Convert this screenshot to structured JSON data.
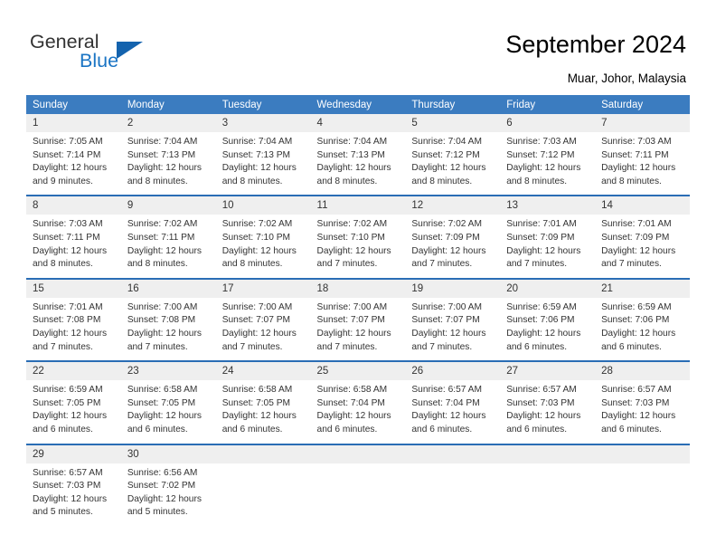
{
  "brand": {
    "name_top": "General",
    "name_bottom": "Blue",
    "triangle_color": "#1463ae",
    "text_color": "#333333",
    "blue_color": "#1a74c4"
  },
  "header": {
    "title": "September 2024",
    "location": "Muar, Johor, Malaysia"
  },
  "theme": {
    "header_row_bg": "#3b7cc0",
    "header_row_text": "#ffffff",
    "daynum_bg": "#efefef",
    "week_separator": "#2a6db5",
    "body_text": "#333333"
  },
  "weekday_headers": [
    "Sunday",
    "Monday",
    "Tuesday",
    "Wednesday",
    "Thursday",
    "Friday",
    "Saturday"
  ],
  "labels": {
    "sunrise_prefix": "Sunrise: ",
    "sunset_prefix": "Sunset: ",
    "daylight_prefix": "Daylight: "
  },
  "weeks": [
    [
      {
        "day": "1",
        "sunrise": "Sunrise: 7:05 AM",
        "sunset": "Sunset: 7:14 PM",
        "daylight": "Daylight: 12 hours and 9 minutes."
      },
      {
        "day": "2",
        "sunrise": "Sunrise: 7:04 AM",
        "sunset": "Sunset: 7:13 PM",
        "daylight": "Daylight: 12 hours and 8 minutes."
      },
      {
        "day": "3",
        "sunrise": "Sunrise: 7:04 AM",
        "sunset": "Sunset: 7:13 PM",
        "daylight": "Daylight: 12 hours and 8 minutes."
      },
      {
        "day": "4",
        "sunrise": "Sunrise: 7:04 AM",
        "sunset": "Sunset: 7:13 PM",
        "daylight": "Daylight: 12 hours and 8 minutes."
      },
      {
        "day": "5",
        "sunrise": "Sunrise: 7:04 AM",
        "sunset": "Sunset: 7:12 PM",
        "daylight": "Daylight: 12 hours and 8 minutes."
      },
      {
        "day": "6",
        "sunrise": "Sunrise: 7:03 AM",
        "sunset": "Sunset: 7:12 PM",
        "daylight": "Daylight: 12 hours and 8 minutes."
      },
      {
        "day": "7",
        "sunrise": "Sunrise: 7:03 AM",
        "sunset": "Sunset: 7:11 PM",
        "daylight": "Daylight: 12 hours and 8 minutes."
      }
    ],
    [
      {
        "day": "8",
        "sunrise": "Sunrise: 7:03 AM",
        "sunset": "Sunset: 7:11 PM",
        "daylight": "Daylight: 12 hours and 8 minutes."
      },
      {
        "day": "9",
        "sunrise": "Sunrise: 7:02 AM",
        "sunset": "Sunset: 7:11 PM",
        "daylight": "Daylight: 12 hours and 8 minutes."
      },
      {
        "day": "10",
        "sunrise": "Sunrise: 7:02 AM",
        "sunset": "Sunset: 7:10 PM",
        "daylight": "Daylight: 12 hours and 8 minutes."
      },
      {
        "day": "11",
        "sunrise": "Sunrise: 7:02 AM",
        "sunset": "Sunset: 7:10 PM",
        "daylight": "Daylight: 12 hours and 7 minutes."
      },
      {
        "day": "12",
        "sunrise": "Sunrise: 7:02 AM",
        "sunset": "Sunset: 7:09 PM",
        "daylight": "Daylight: 12 hours and 7 minutes."
      },
      {
        "day": "13",
        "sunrise": "Sunrise: 7:01 AM",
        "sunset": "Sunset: 7:09 PM",
        "daylight": "Daylight: 12 hours and 7 minutes."
      },
      {
        "day": "14",
        "sunrise": "Sunrise: 7:01 AM",
        "sunset": "Sunset: 7:09 PM",
        "daylight": "Daylight: 12 hours and 7 minutes."
      }
    ],
    [
      {
        "day": "15",
        "sunrise": "Sunrise: 7:01 AM",
        "sunset": "Sunset: 7:08 PM",
        "daylight": "Daylight: 12 hours and 7 minutes."
      },
      {
        "day": "16",
        "sunrise": "Sunrise: 7:00 AM",
        "sunset": "Sunset: 7:08 PM",
        "daylight": "Daylight: 12 hours and 7 minutes."
      },
      {
        "day": "17",
        "sunrise": "Sunrise: 7:00 AM",
        "sunset": "Sunset: 7:07 PM",
        "daylight": "Daylight: 12 hours and 7 minutes."
      },
      {
        "day": "18",
        "sunrise": "Sunrise: 7:00 AM",
        "sunset": "Sunset: 7:07 PM",
        "daylight": "Daylight: 12 hours and 7 minutes."
      },
      {
        "day": "19",
        "sunrise": "Sunrise: 7:00 AM",
        "sunset": "Sunset: 7:07 PM",
        "daylight": "Daylight: 12 hours and 7 minutes."
      },
      {
        "day": "20",
        "sunrise": "Sunrise: 6:59 AM",
        "sunset": "Sunset: 7:06 PM",
        "daylight": "Daylight: 12 hours and 6 minutes."
      },
      {
        "day": "21",
        "sunrise": "Sunrise: 6:59 AM",
        "sunset": "Sunset: 7:06 PM",
        "daylight": "Daylight: 12 hours and 6 minutes."
      }
    ],
    [
      {
        "day": "22",
        "sunrise": "Sunrise: 6:59 AM",
        "sunset": "Sunset: 7:05 PM",
        "daylight": "Daylight: 12 hours and 6 minutes."
      },
      {
        "day": "23",
        "sunrise": "Sunrise: 6:58 AM",
        "sunset": "Sunset: 7:05 PM",
        "daylight": "Daylight: 12 hours and 6 minutes."
      },
      {
        "day": "24",
        "sunrise": "Sunrise: 6:58 AM",
        "sunset": "Sunset: 7:05 PM",
        "daylight": "Daylight: 12 hours and 6 minutes."
      },
      {
        "day": "25",
        "sunrise": "Sunrise: 6:58 AM",
        "sunset": "Sunset: 7:04 PM",
        "daylight": "Daylight: 12 hours and 6 minutes."
      },
      {
        "day": "26",
        "sunrise": "Sunrise: 6:57 AM",
        "sunset": "Sunset: 7:04 PM",
        "daylight": "Daylight: 12 hours and 6 minutes."
      },
      {
        "day": "27",
        "sunrise": "Sunrise: 6:57 AM",
        "sunset": "Sunset: 7:03 PM",
        "daylight": "Daylight: 12 hours and 6 minutes."
      },
      {
        "day": "28",
        "sunrise": "Sunrise: 6:57 AM",
        "sunset": "Sunset: 7:03 PM",
        "daylight": "Daylight: 12 hours and 6 minutes."
      }
    ],
    [
      {
        "day": "29",
        "sunrise": "Sunrise: 6:57 AM",
        "sunset": "Sunset: 7:03 PM",
        "daylight": "Daylight: 12 hours and 5 minutes."
      },
      {
        "day": "30",
        "sunrise": "Sunrise: 6:56 AM",
        "sunset": "Sunset: 7:02 PM",
        "daylight": "Daylight: 12 hours and 5 minutes."
      },
      {
        "day": "",
        "sunrise": "",
        "sunset": "",
        "daylight": ""
      },
      {
        "day": "",
        "sunrise": "",
        "sunset": "",
        "daylight": ""
      },
      {
        "day": "",
        "sunrise": "",
        "sunset": "",
        "daylight": ""
      },
      {
        "day": "",
        "sunrise": "",
        "sunset": "",
        "daylight": ""
      },
      {
        "day": "",
        "sunrise": "",
        "sunset": "",
        "daylight": ""
      }
    ]
  ]
}
